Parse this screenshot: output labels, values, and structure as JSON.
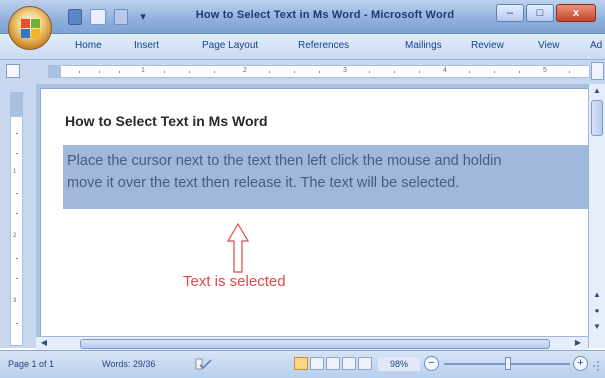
{
  "window": {
    "title": "How to Select Text in Ms Word - Microsoft Word",
    "minimize": "–",
    "maximize": "□",
    "close": "x",
    "qat_more": "▾"
  },
  "ribbon": {
    "tabs": [
      "Home",
      "Insert",
      "Page Layout",
      "References",
      "Mailings",
      "Review",
      "View",
      "Ad"
    ]
  },
  "ruler": {
    "numbers": [
      "1",
      "2",
      "3",
      "4",
      "5"
    ]
  },
  "vertical_ruler": {
    "numbers": [
      "1",
      "2",
      "3"
    ]
  },
  "document": {
    "heading": "How to Select Text in Ms Word",
    "paragraph_lines": [
      "Place the cursor next to the text then left click the mouse and holdin",
      "move it over the text then release it. The text will be selected."
    ],
    "annotation": "Text is selected"
  },
  "statusbar": {
    "page": "Page 1 of 1",
    "words": "Words: 29/36",
    "zoom": "98%",
    "zoom_out": "−",
    "zoom_in": "+"
  },
  "colors": {
    "selection": "#9fb8dc",
    "annotation": "#e04848",
    "ribbon_text": "#15428b",
    "title_bar": "#8fb0dc"
  },
  "icons": {
    "office_button": "office-logo-icon",
    "save": "save-icon",
    "undo": "undo-icon",
    "repeat": "repeat-icon",
    "arrow": "up-arrow-icon",
    "proofing": "proofing-check-icon"
  }
}
